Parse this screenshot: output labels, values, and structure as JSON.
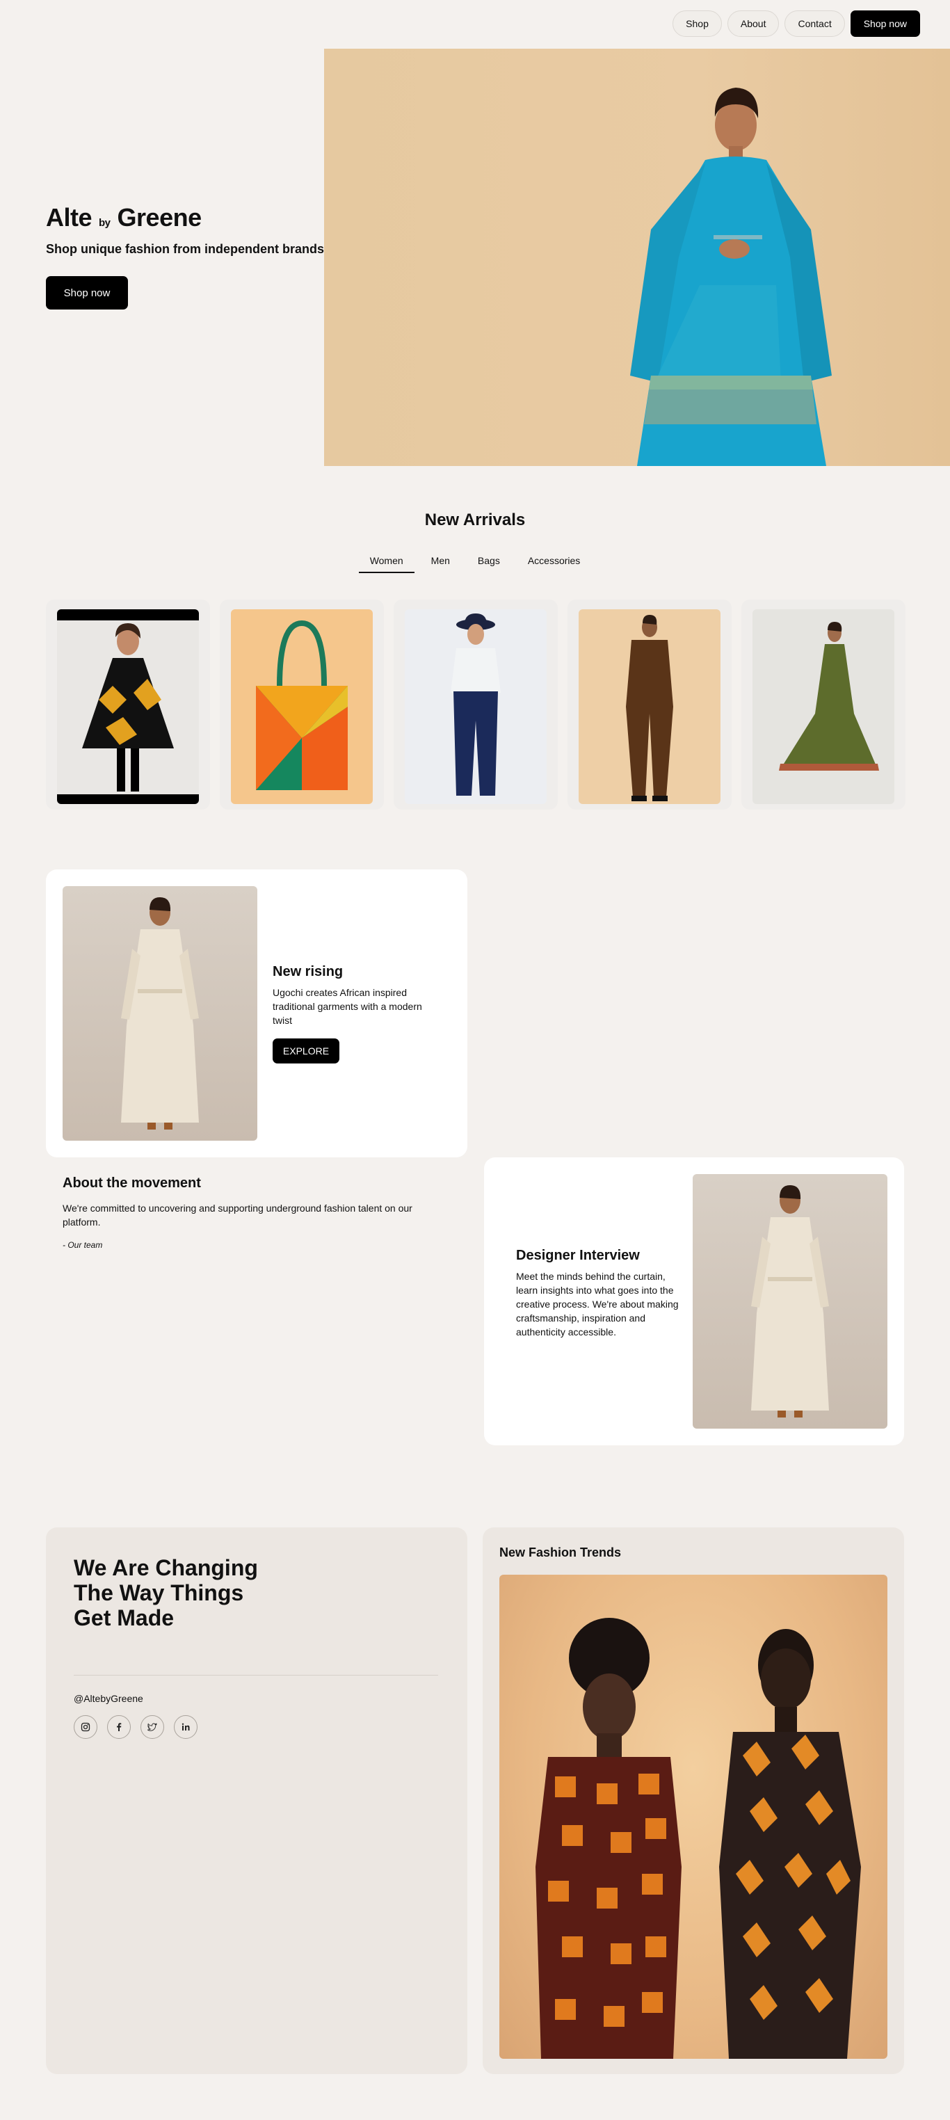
{
  "nav": {
    "links": [
      "Shop",
      "About",
      "Contact"
    ],
    "cta": "Shop now"
  },
  "hero": {
    "brand_first": "Alte",
    "brand_by": "by",
    "brand_last": "Greene",
    "tagline": "Shop unique fashion from independent brands",
    "cta": "Shop now"
  },
  "arrivals": {
    "title": "New Arrivals",
    "tabs": [
      "Women",
      "Men",
      "Bags",
      "Accessories"
    ],
    "active_tab": "Women",
    "products": [
      "poncho",
      "tote-bag",
      "white-tee-navy-trousers",
      "brown-jumpsuit",
      "olive-dress"
    ]
  },
  "rising": {
    "title": "New rising",
    "body": "Ugochi creates African inspired traditional garments with a modern twist",
    "cta": "EXPLORE"
  },
  "about": {
    "title": "About the movement",
    "body": "We're committed to uncovering and supporting underground fashion talent on our platform.",
    "signature": "- Our team"
  },
  "interview": {
    "title": "Designer Interview",
    "body": "Meet the minds behind the curtain, learn insights into what goes into the creative process. We're about making craftsmanship, inspiration and authenticity accessible."
  },
  "footer": {
    "headline": "We Are Changing\nThe Way Things\nGet Made",
    "handle": "@AltebyGreene",
    "socials": [
      "instagram-icon",
      "facebook-icon",
      "twitter-icon",
      "linkedin-icon"
    ]
  },
  "trends": {
    "title": "New Fashion Trends"
  },
  "colors": {
    "accent": "#000000",
    "background": "#f4f1ee",
    "hero_bg": "#e6c9a0",
    "dress_blue": "#1aa6cf"
  }
}
